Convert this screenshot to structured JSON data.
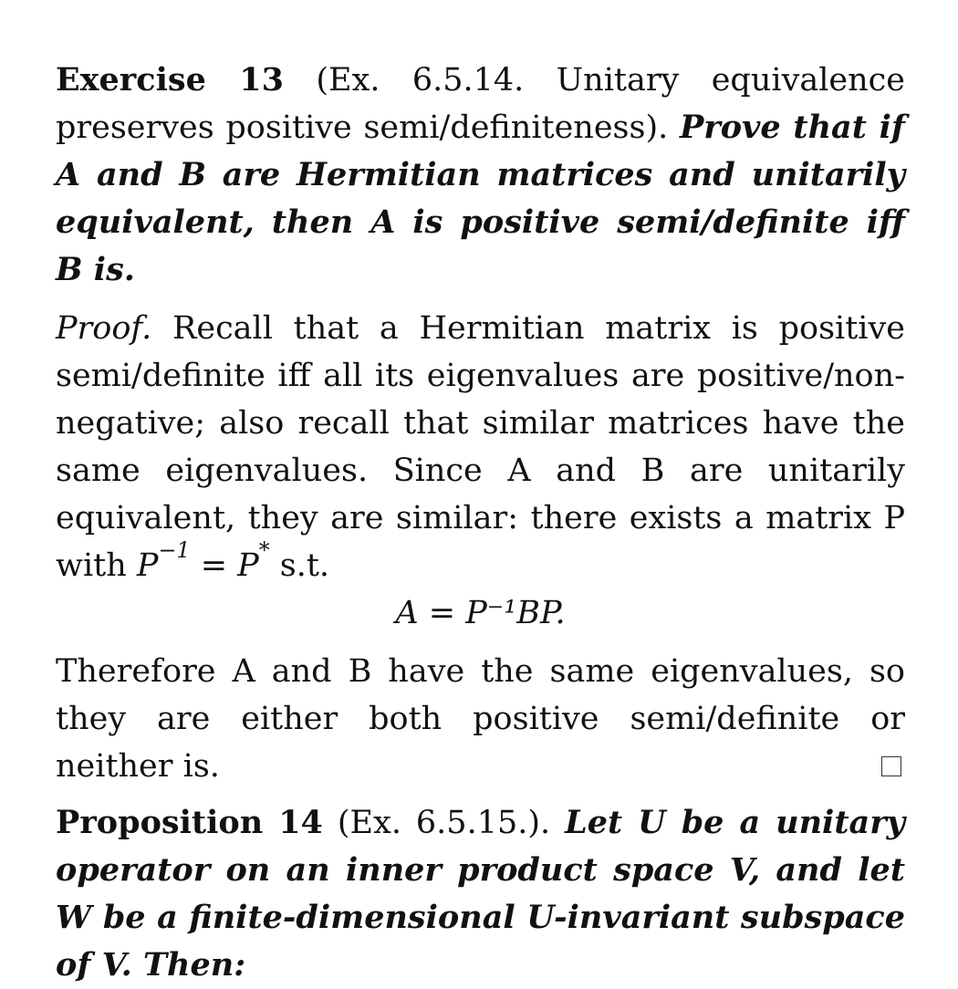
{
  "exercise": {
    "label": "Exercise 13",
    "note": "(Ex. 6.5.14. Unitary equivalence preserves positive semi/definiteness).",
    "statement": "Prove that if A and B are Hermitian matrices and unitarily equivalent, then A is positive semi/definite iff B is."
  },
  "proof": {
    "label": "Proof.",
    "text1": "Recall that a Hermitian matrix is positive semi/definite iff all its eigenvalues are positive/non-negative; also recall that similar matrices have the same eigenvalues. Since A and B are unitarily equivalent, they are similar: there exists a matrix P with",
    "text2": "s.t.",
    "display_eq": "A = P⁻¹BP.",
    "text3": "Therefore A and B have the same eigenvalues, so they are either both positive semi/definite or neither is."
  },
  "proposition": {
    "label": "Proposition 14",
    "note": "(Ex. 6.5.15.).",
    "statement": "Let U be a unitary operator on an inner product space V, and let W be a finite-dimensional U-invariant subspace of V. Then:"
  }
}
